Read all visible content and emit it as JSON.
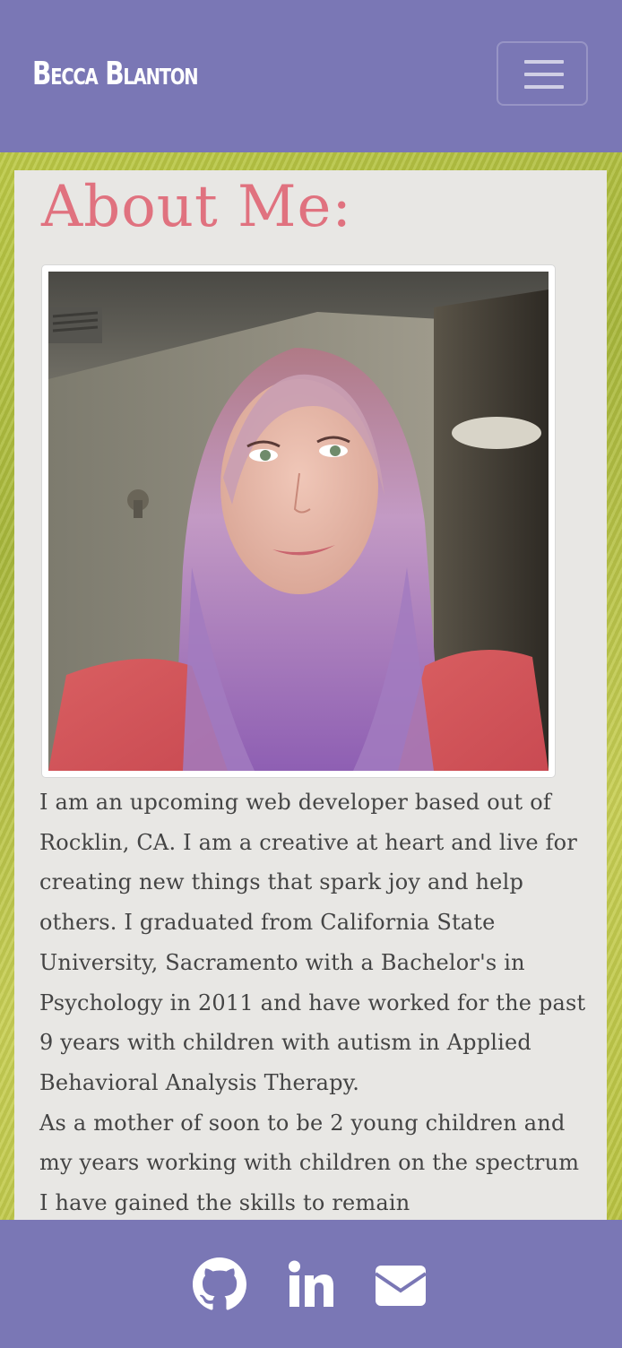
{
  "navbar": {
    "brand": "Becca Blanton",
    "toggle_icon": "hamburger-menu-icon"
  },
  "about": {
    "title": "About Me:",
    "photo_alt": "Becca Blanton",
    "paragraphs": [
      "I am an upcoming web developer based out of Rocklin, CA. I am a creative at heart and live for creating new things that spark joy and help others. I graduated from California State University, Sacramento with a Bachelor's in Psychology in 2011 and have worked for the past 9 years with children with autism in Applied Behavioral Analysis Therapy.",
      "As a mother of soon to be 2 young children and my years working with children on the spectrum I have gained the skills to remain"
    ]
  },
  "footer": {
    "icons": [
      "github-icon",
      "linkedin-icon",
      "envelope-icon"
    ]
  },
  "colors": {
    "nav_bg": "#7a77b5",
    "title": "#e0727f",
    "card_bg": "#e8e7e4",
    "page_bg": "#b9c449"
  }
}
